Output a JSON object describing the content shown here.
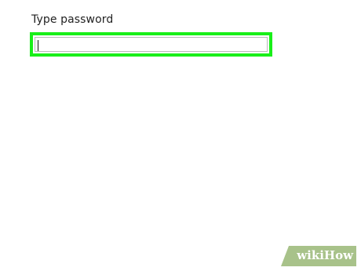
{
  "password_field": {
    "label": "Type password",
    "value": "",
    "highlight_color": "#19ef19"
  },
  "watermark": {
    "brand_prefix": "wiki",
    "brand_suffix": "How",
    "color": "#a8c28a"
  }
}
